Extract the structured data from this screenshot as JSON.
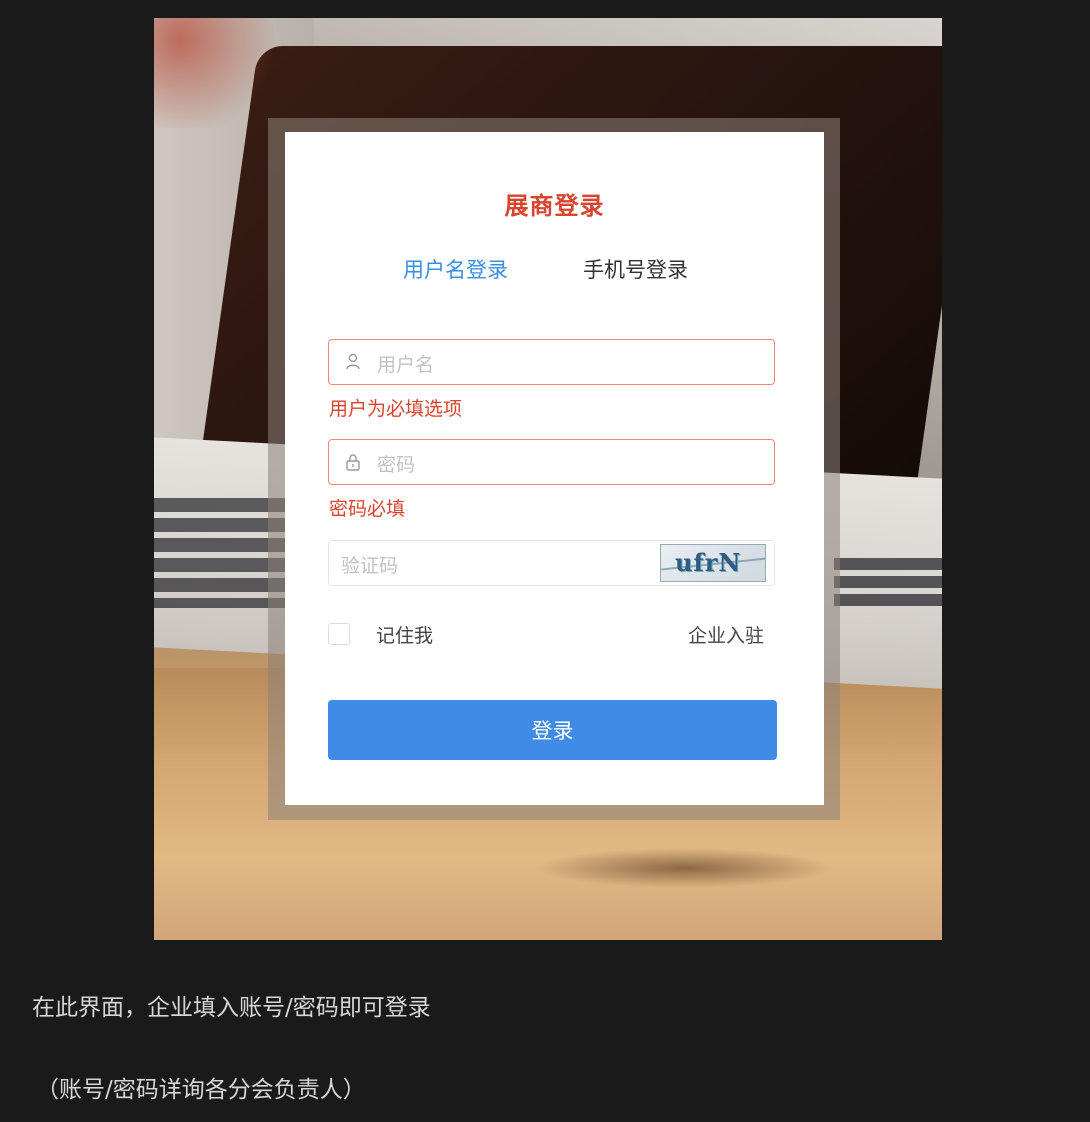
{
  "login": {
    "title": "展商登录",
    "tabs": [
      {
        "label": "用户名登录",
        "active": true
      },
      {
        "label": "手机号登录",
        "active": false
      }
    ],
    "username": {
      "placeholder": "用户名",
      "error": "用户为必填选项",
      "icon": "user-icon"
    },
    "password": {
      "placeholder": "密码",
      "error": "密码必填",
      "icon": "lock-icon"
    },
    "captcha": {
      "placeholder": "验证码",
      "image_text": "ufrN"
    },
    "remember_label": "记住我",
    "enterprise_link": "企业入驻",
    "submit_label": "登录"
  },
  "colors": {
    "title_red": "#d9442f",
    "active_tab_blue": "#3a8ee6",
    "button_blue": "#3f8be6",
    "error_border": "#f08a77"
  },
  "caption": {
    "line1": "在此界面，企业填入账号/密码即可登录",
    "line2": "（账号/密码详询各分会负责人）"
  }
}
